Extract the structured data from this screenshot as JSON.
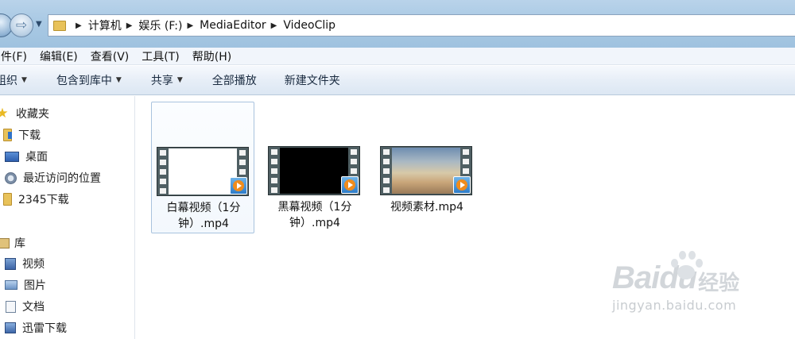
{
  "address": {
    "crumbs": [
      "计算机",
      "娱乐 (F:)",
      "MediaEditor",
      "VideoClip"
    ]
  },
  "menu": [
    "件(F)",
    "编辑(E)",
    "查看(V)",
    "工具(T)",
    "帮助(H)"
  ],
  "toolbar": {
    "organize": "组织",
    "include_library": "包含到库中",
    "share": "共享",
    "play_all": "全部播放",
    "new_folder": "新建文件夹"
  },
  "sidebar": {
    "favorites": {
      "label": "收藏夹",
      "items": [
        "下载",
        "桌面",
        "最近访问的位置",
        "2345下载"
      ]
    },
    "libraries": {
      "label": "库",
      "items": [
        "视频",
        "图片",
        "文档",
        "迅雷下载"
      ]
    }
  },
  "files": [
    {
      "name_line1": "白幕视频（1分",
      "name_line2": "钟）.mp4",
      "thumb": "white",
      "selected": true
    },
    {
      "name_line1": "黑幕视频（1分",
      "name_line2": "钟）.mp4",
      "thumb": "black",
      "selected": false
    },
    {
      "name_line1": "视频素材.mp4",
      "name_line2": "",
      "thumb": "sky",
      "selected": false
    }
  ],
  "watermark": {
    "logo": "Baidu",
    "cn": "经验",
    "url": "jingyan.baidu.com"
  }
}
